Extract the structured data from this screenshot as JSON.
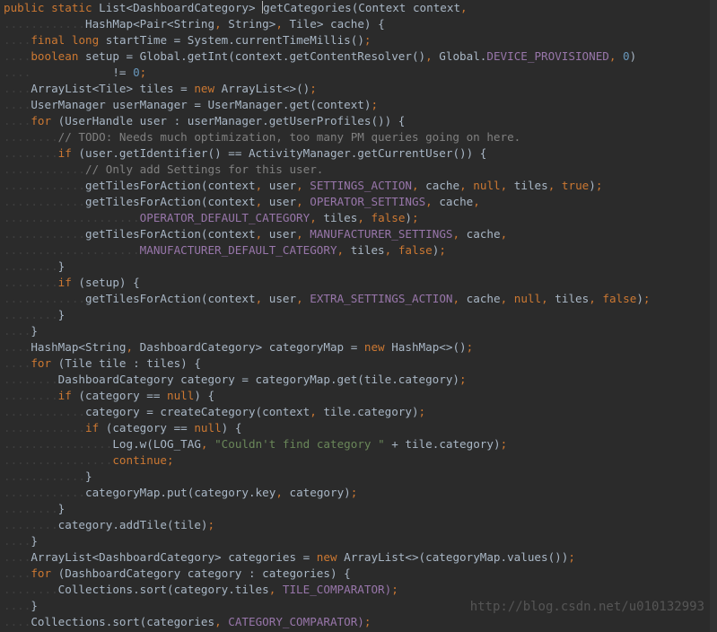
{
  "watermark": "http://blog.csdn.net/u010132993",
  "tokens": {
    "public": "public",
    "static": "static",
    "final": "final",
    "long": "long",
    "boolean": "boolean",
    "new": "new",
    "for": "for",
    "if": "if",
    "continue": "continue",
    "null": "null",
    "true": "true",
    "false": "false"
  },
  "nums": {
    "zero": "0"
  },
  "strings": {
    "couldnt": "\"Couldn't find category \""
  },
  "comments": {
    "todo": "// TODO: Needs much optimization, too many PM queries going on here.",
    "only": "// Only add Settings for this user."
  },
  "txt": {
    "l1a": " List<DashboardCategory> ",
    "l1b": "getCategories(Context context",
    "l2": "HashMap<Pair<String",
    "l2b": " String>",
    "l2c": " Tile> cache) {",
    "l3a": " startTime = System.currentTimeMillis()",
    "l4a": " setup = Global.getInt(context.getContentResolver()",
    "l4b": " Global.",
    "l4c": "DEVICE_PROVISIONED",
    "l4d": ")",
    "l5": "            != ",
    "l6a": "ArrayList<Tile> tiles = ",
    "l6b": " ArrayList<>()",
    "l7": "UserManager userManager = UserManager.get(context)",
    "l8a": " (UserHandle user : userManager.getUserProfiles()) {",
    "l10a": " (user.getIdentifier() == ActivityManager.getCurrentUser()) {",
    "l12a": "getTilesForAction(context",
    "l12b": " user",
    "l12c": " SETTINGS_ACTION",
    "l12d": " cache",
    "l12e": " tiles",
    "l12f": ")",
    "l13c": " OPERATOR_SETTINGS",
    "l14a": "OPERATOR_DEFAULT_CATEGORY",
    "l15c": " MANUFACTURER_SETTINGS",
    "l16a": "MANUFACTURER_DEFAULT_CATEGORY",
    "l19a": " (setup) {",
    "l20c": " EXTRA_SETTINGS_ACTION",
    "l23a": "HashMap<String",
    "l23b": " DashboardCategory> categoryMap = ",
    "l23c": " HashMap<>()",
    "l24a": " (Tile tile : tiles) {",
    "l25a": "DashboardCategory category = categoryMap.get(tile.category)",
    "l26a": " (category == ",
    "l26b": ") {",
    "l27a": "category = createCategory(context",
    "l27b": " tile.category)",
    "l29a": "Log.w(LOG_TAG",
    "l29b": " + tile.category)",
    "l32a": "categoryMap.put(category.key",
    "l32b": " category)",
    "l34a": "category.addTile(tile)",
    "l36a": "ArrayList<DashboardCategory> categories = ",
    "l36b": " ArrayList<>(categoryMap.values())",
    "l37a": " (DashboardCategory category : categories) {",
    "l38a": "Collections.sort(category.tiles",
    "l38b": " TILE_COMPARATOR)",
    "l40a": "Collections.sort(categories",
    "l40b": " CATEGORY_COMPARATOR)"
  },
  "punct": {
    "semi": ";",
    "comma": ",",
    "lbrace": "{",
    "rbrace": "}",
    "lpar": "(",
    "rpar": ")"
  },
  "dots": {
    "d4": "....",
    "d8": "........",
    "d12": "............",
    "d16": "................",
    "d20": "....................",
    "d24": "........................"
  }
}
